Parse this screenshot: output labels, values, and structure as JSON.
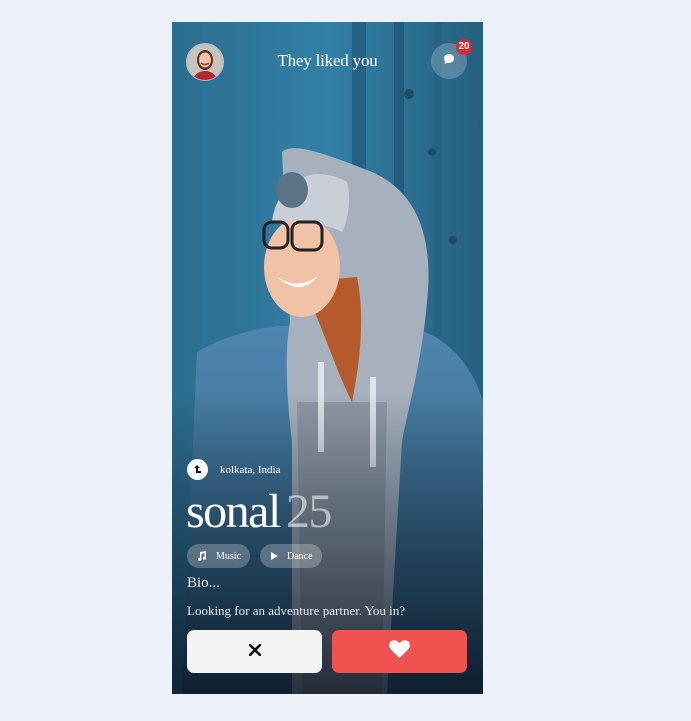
{
  "header": {
    "title": "They liked you",
    "notification_count": "20",
    "avatar_icon": "user-avatar",
    "chat_icon": "chat-bubble-icon"
  },
  "profile": {
    "location": "kolkata, India",
    "name": "sonal",
    "age": "25",
    "interests": [
      {
        "label": "Music",
        "icon": "music-note-icon"
      },
      {
        "label": "Dance",
        "icon": "play-icon"
      }
    ],
    "bio_heading": "Bio...",
    "bio_text": "Looking for an adventure partner. You in?"
  },
  "actions": {
    "pass_icon": "close-icon",
    "like_icon": "heart-icon"
  },
  "colors": {
    "page_background": "#edf1f9",
    "like_button": "#ef524f",
    "pass_button": "#f4f4f4",
    "badge": "#e3262c"
  }
}
